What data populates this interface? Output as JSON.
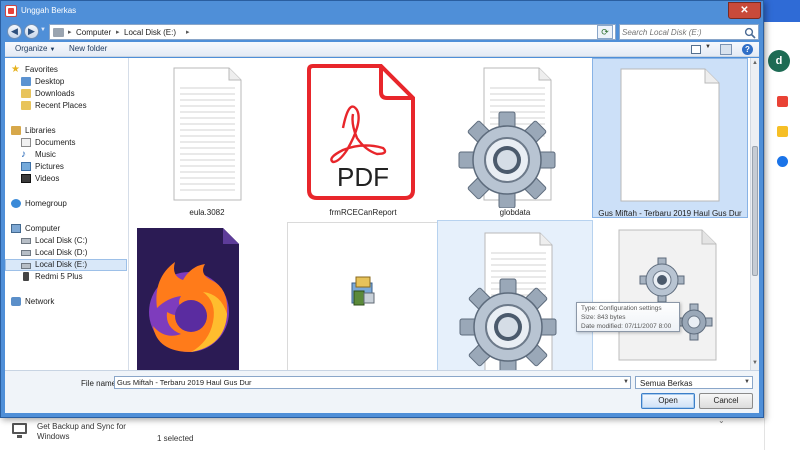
{
  "dialog": {
    "title": "Unggah Berkas",
    "close_glyph": "✕"
  },
  "address": {
    "crumbs": [
      "Computer",
      "Local Disk (E:)"
    ],
    "search_placeholder": "Search Local Disk (E:)"
  },
  "toolbar": {
    "organize_label": "Organize",
    "new_folder_label": "New folder",
    "help_glyph": "?"
  },
  "nav": {
    "favorites": "Favorites",
    "desktop": "Desktop",
    "downloads": "Downloads",
    "recent_places": "Recent Places",
    "libraries": "Libraries",
    "documents": "Documents",
    "music": "Music",
    "pictures": "Pictures",
    "videos": "Videos",
    "homegroup": "Homegroup",
    "computer": "Computer",
    "disk_c": "Local Disk (C:)",
    "disk_d": "Local Disk (D:)",
    "disk_e": "Local Disk (E:)",
    "redmi": "Redmi 5 Plus",
    "network": "Network"
  },
  "files": [
    {
      "name": "eula.3082",
      "icon": "text-document-icon"
    },
    {
      "name": "frmRCECanReport",
      "icon": "pdf-icon",
      "badge": "PDF"
    },
    {
      "name": "globdata",
      "icon": "gear-document-icon"
    },
    {
      "name": "Gus Miftah - Terbaru 2019 Haul Gus Dur",
      "icon": "blank-document-icon"
    },
    {
      "name": "",
      "icon": "firefox-icon"
    },
    {
      "name": "",
      "icon": "installer-icon"
    },
    {
      "name": "",
      "icon": "gear-document-icon"
    },
    {
      "name": "",
      "icon": "config-settings-icon"
    }
  ],
  "tooltip": {
    "type": "Type: Configuration settings",
    "size": "Size: 843 bytes",
    "modified": "Date modified: 07/11/2007 8:00"
  },
  "bottom": {
    "file_name_label": "File name:",
    "file_name_value": "Gus Miftah - Terbaru 2019 Haul Gus Dur",
    "type_filter": "Semua Berkas",
    "open_label": "Open",
    "cancel_label": "Cancel"
  },
  "background": {
    "avatar_letter": "d",
    "sync_text": "Get Backup and Sync for Windows",
    "selected_text": "1 selected"
  },
  "colors": {
    "title_bar": "#4f8fd8",
    "selection": "#cce0f8",
    "pdf_red": "#e8262b"
  }
}
